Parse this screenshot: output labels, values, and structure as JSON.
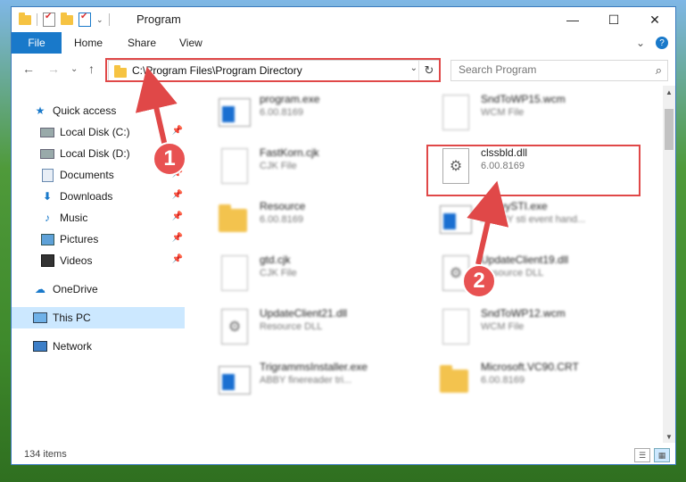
{
  "window": {
    "title": "Program"
  },
  "titlebar": {
    "minimize": "—",
    "maximize": "☐",
    "close": "✕"
  },
  "ribbon": {
    "tabs": [
      {
        "label": "File"
      },
      {
        "label": "Home"
      },
      {
        "label": "Share"
      },
      {
        "label": "View"
      }
    ],
    "expand": "⌄",
    "help": "?"
  },
  "nav": {
    "back": "←",
    "forward": "→",
    "recent": "⌄",
    "up": "↑"
  },
  "address": {
    "path": "C:\\Program Files\\Program Directory",
    "dropdown": "⌄",
    "refresh": "↻"
  },
  "search": {
    "placeholder": "Search Program",
    "icon": "⌕"
  },
  "sidebar": {
    "items": [
      {
        "label": "Quick access",
        "icon": "star-icon",
        "glyph": "★"
      },
      {
        "label": "Local Disk (C:)",
        "icon": "disk-icon",
        "pinned": true
      },
      {
        "label": "Local Disk (D:)",
        "icon": "disk-icon",
        "pinned": false
      },
      {
        "label": "Documents",
        "icon": "documents-icon",
        "pinned": true
      },
      {
        "label": "Downloads",
        "icon": "downloads-icon",
        "glyph": "⬇",
        "pinned": true
      },
      {
        "label": "Music",
        "icon": "music-icon",
        "glyph": "♪",
        "pinned": true
      },
      {
        "label": "Pictures",
        "icon": "pictures-icon",
        "pinned": true
      },
      {
        "label": "Videos",
        "icon": "videos-icon",
        "pinned": true
      },
      {
        "label": "OneDrive",
        "icon": "cloud-icon",
        "glyph": "☁"
      },
      {
        "label": "This PC",
        "icon": "pc-icon",
        "selected": true
      },
      {
        "label": "Network",
        "icon": "network-icon"
      }
    ],
    "pin_glyph": "📌"
  },
  "files": [
    {
      "name": "program.exe",
      "sub": "6.00.8169",
      "type": "exe"
    },
    {
      "name": "SndToWP15.wcm",
      "sub": "WCM File",
      "type": "doc"
    },
    {
      "name": "FastKorn.cjk",
      "sub": "CJK File",
      "type": "doc"
    },
    {
      "name": "clssbld.dll",
      "sub": "6.00.8169",
      "type": "dll",
      "highlighted": true
    },
    {
      "name": "Resource",
      "sub": "6.00.8169",
      "type": "folder"
    },
    {
      "name": "AbbyySTI.exe",
      "sub": "ABBYY sti event hand...",
      "type": "exe"
    },
    {
      "name": "gtd.cjk",
      "sub": "CJK File",
      "type": "doc"
    },
    {
      "name": "UpdateClient19.dll",
      "sub": "Resource DLL",
      "type": "dll"
    },
    {
      "name": "UpdateClient21.dll",
      "sub": "Resource DLL",
      "type": "dll"
    },
    {
      "name": "SndToWP12.wcm",
      "sub": "WCM File",
      "type": "doc"
    },
    {
      "name": "TrigrammsInstaller.exe",
      "sub": "ABBY finereader tri...",
      "type": "exe"
    },
    {
      "name": "Microsoft.VC90.CRT",
      "sub": "6.00.8169",
      "type": "folder"
    }
  ],
  "dll_glyph": "⚙",
  "status": {
    "count": "134 items",
    "details_view": "☰",
    "tiles_view": "▦"
  },
  "annotations": {
    "marker1": "1",
    "marker2": "2",
    "color": "#e04848"
  },
  "scrollbar": {
    "up": "▲",
    "down": "▼"
  }
}
